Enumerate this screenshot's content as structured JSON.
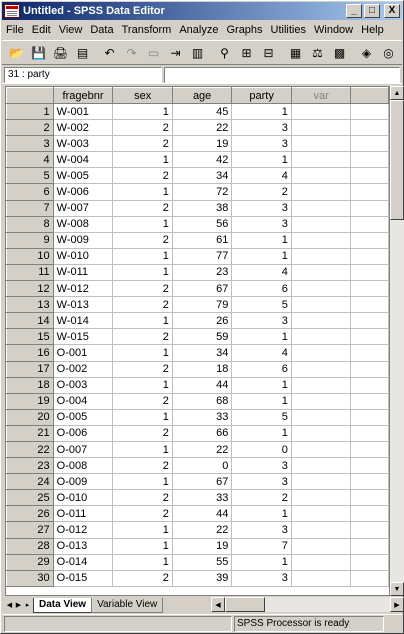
{
  "window": {
    "title": "Untitled - SPSS Data Editor",
    "minimize_glyph": "_",
    "maximize_glyph": "□",
    "close_glyph": "X"
  },
  "menu": {
    "items": [
      "File",
      "Edit",
      "View",
      "Data",
      "Transform",
      "Analyze",
      "Graphs",
      "Utilities",
      "Window",
      "Help"
    ]
  },
  "toolbar": {
    "tools": [
      {
        "name": "open-icon",
        "glyph": "📂"
      },
      {
        "name": "save-icon",
        "glyph": "💾"
      },
      {
        "name": "print-icon",
        "glyph": "🖨"
      },
      {
        "name": "dialog-recall-icon",
        "glyph": "▤"
      },
      {
        "name": "undo-icon",
        "glyph": "↶"
      },
      {
        "name": "redo-icon",
        "glyph": "↷"
      },
      {
        "name": "goto-chart-icon",
        "glyph": "▭"
      },
      {
        "name": "goto-case-icon",
        "glyph": "⇥"
      },
      {
        "name": "variables-icon",
        "glyph": "▥"
      },
      {
        "name": "find-icon",
        "glyph": "⚲"
      },
      {
        "name": "insert-case-icon",
        "glyph": "⊞"
      },
      {
        "name": "insert-variable-icon",
        "glyph": "⊟"
      },
      {
        "name": "split-file-icon",
        "glyph": "▦"
      },
      {
        "name": "weight-cases-icon",
        "glyph": "⚖"
      },
      {
        "name": "select-cases-icon",
        "glyph": "▩"
      },
      {
        "name": "value-labels-icon",
        "glyph": "◈"
      },
      {
        "name": "use-sets-icon",
        "glyph": "◎"
      }
    ]
  },
  "cellbar": {
    "reference": "31 : party",
    "value": ""
  },
  "grid": {
    "columns": [
      "fragebnr",
      "sex",
      "age",
      "party",
      "var"
    ],
    "rows": [
      {
        "n": "1",
        "fragebnr": "W-001",
        "sex": "1",
        "age": "45",
        "party": "1"
      },
      {
        "n": "2",
        "fragebnr": "W-002",
        "sex": "2",
        "age": "22",
        "party": "3"
      },
      {
        "n": "3",
        "fragebnr": "W-003",
        "sex": "2",
        "age": "19",
        "party": "3"
      },
      {
        "n": "4",
        "fragebnr": "W-004",
        "sex": "1",
        "age": "42",
        "party": "1"
      },
      {
        "n": "5",
        "fragebnr": "W-005",
        "sex": "2",
        "age": "34",
        "party": "4"
      },
      {
        "n": "6",
        "fragebnr": "W-006",
        "sex": "1",
        "age": "72",
        "party": "2"
      },
      {
        "n": "7",
        "fragebnr": "W-007",
        "sex": "2",
        "age": "38",
        "party": "3"
      },
      {
        "n": "8",
        "fragebnr": "W-008",
        "sex": "1",
        "age": "56",
        "party": "3"
      },
      {
        "n": "9",
        "fragebnr": "W-009",
        "sex": "2",
        "age": "61",
        "party": "1"
      },
      {
        "n": "10",
        "fragebnr": "W-010",
        "sex": "1",
        "age": "77",
        "party": "1"
      },
      {
        "n": "11",
        "fragebnr": "W-011",
        "sex": "1",
        "age": "23",
        "party": "4"
      },
      {
        "n": "12",
        "fragebnr": "W-012",
        "sex": "2",
        "age": "67",
        "party": "6"
      },
      {
        "n": "13",
        "fragebnr": "W-013",
        "sex": "2",
        "age": "79",
        "party": "5"
      },
      {
        "n": "14",
        "fragebnr": "W-014",
        "sex": "1",
        "age": "26",
        "party": "3"
      },
      {
        "n": "15",
        "fragebnr": "W-015",
        "sex": "2",
        "age": "59",
        "party": "1"
      },
      {
        "n": "16",
        "fragebnr": "O-001",
        "sex": "1",
        "age": "34",
        "party": "4"
      },
      {
        "n": "17",
        "fragebnr": "O-002",
        "sex": "2",
        "age": "18",
        "party": "6"
      },
      {
        "n": "18",
        "fragebnr": "O-003",
        "sex": "1",
        "age": "44",
        "party": "1"
      },
      {
        "n": "19",
        "fragebnr": "O-004",
        "sex": "2",
        "age": "68",
        "party": "1"
      },
      {
        "n": "20",
        "fragebnr": "O-005",
        "sex": "1",
        "age": "33",
        "party": "5"
      },
      {
        "n": "21",
        "fragebnr": "O-006",
        "sex": "2",
        "age": "66",
        "party": "1"
      },
      {
        "n": "22",
        "fragebnr": "O-007",
        "sex": "1",
        "age": "22",
        "party": "0"
      },
      {
        "n": "23",
        "fragebnr": "O-008",
        "sex": "2",
        "age": "0",
        "party": "3"
      },
      {
        "n": "24",
        "fragebnr": "O-009",
        "sex": "1",
        "age": "67",
        "party": "3"
      },
      {
        "n": "25",
        "fragebnr": "O-010",
        "sex": "2",
        "age": "33",
        "party": "2"
      },
      {
        "n": "26",
        "fragebnr": "O-011",
        "sex": "2",
        "age": "44",
        "party": "1"
      },
      {
        "n": "27",
        "fragebnr": "O-012",
        "sex": "1",
        "age": "22",
        "party": "3"
      },
      {
        "n": "28",
        "fragebnr": "O-013",
        "sex": "1",
        "age": "19",
        "party": "7"
      },
      {
        "n": "29",
        "fragebnr": "O-014",
        "sex": "1",
        "age": "55",
        "party": "1"
      },
      {
        "n": "30",
        "fragebnr": "O-015",
        "sex": "2",
        "age": "39",
        "party": "3"
      }
    ]
  },
  "tabs": {
    "nav": [
      "◀",
      "▶",
      "▸"
    ],
    "data_view": "Data View",
    "variable_view": "Variable View"
  },
  "status": {
    "text": "SPSS Processor  is ready"
  }
}
